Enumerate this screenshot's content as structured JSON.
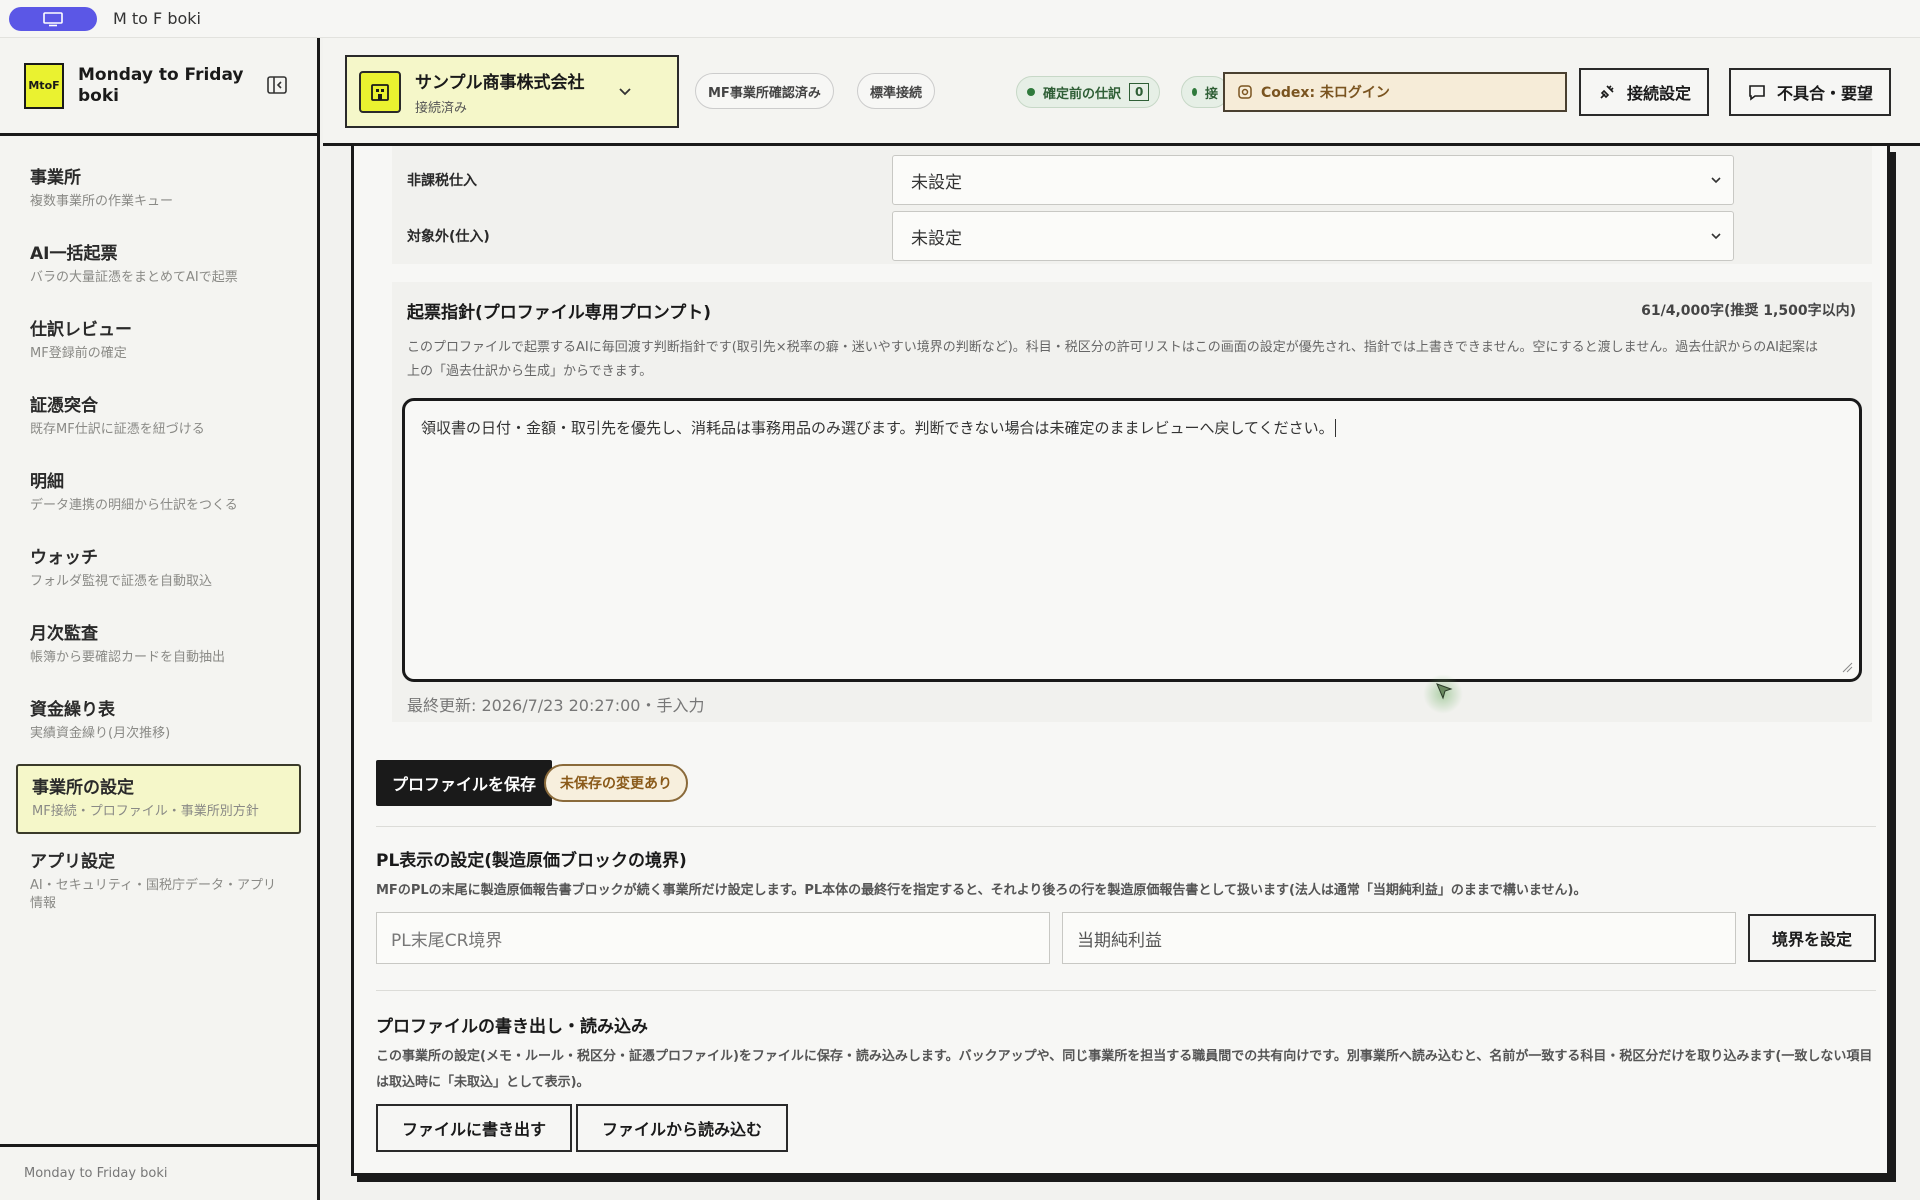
{
  "window": {
    "title": "M to F boki"
  },
  "brand": {
    "logo_text": "MtoF",
    "name": "Monday to Friday boki"
  },
  "sidebar": {
    "items": [
      {
        "title": "事業所",
        "subtitle": "複数事業所の作業キュー"
      },
      {
        "title": "AI一括起票",
        "subtitle": "バラの大量証憑をまとめてAIで起票"
      },
      {
        "title": "仕訳レビュー",
        "subtitle": "MF登録前の確定"
      },
      {
        "title": "証憑突合",
        "subtitle": "既存MF仕訳に証憑を紐づける"
      },
      {
        "title": "明細",
        "subtitle": "データ連携の明細から仕訳をつくる"
      },
      {
        "title": "ウォッチ",
        "subtitle": "フォルダ監視で証憑を自動取込"
      },
      {
        "title": "月次監査",
        "subtitle": "帳簿から要確認カードを自動抽出"
      },
      {
        "title": "資金繰り表",
        "subtitle": "実績資金繰り(月次推移)"
      },
      {
        "title": "事業所の設定",
        "subtitle": "MF接続・プロファイル・事業所別方針"
      },
      {
        "title": "アプリ設定",
        "subtitle": "AI・セキュリティ・国税庁データ・アプリ情報"
      }
    ],
    "footer": "Monday to Friday boki"
  },
  "header": {
    "company_name": "サンプル商事株式会社",
    "company_status": "接続済み",
    "pill_mf_office": "MF事業所確認済み",
    "pill_standard": "標準接続",
    "status_pending": "確定前の仕訳",
    "status_pending_count": "0",
    "status_second": "接",
    "codex_label": "Codex: 未ログイン",
    "connect_button": "接続設定",
    "feedback_button": "不具合・要望"
  },
  "settings": {
    "rows": [
      {
        "label": "非課税仕入",
        "value": "未設定"
      },
      {
        "label": "対象外(仕入)",
        "value": "未設定"
      }
    ]
  },
  "prompt": {
    "title": "起票指針(プロファイル専用プロンプト)",
    "count": "61/4,000字(推奨 1,500字以内)",
    "description": "このプロファイルで起票するAIに毎回渡す判断指針です(取引先×税率の癖・迷いやすい境界の判断など)。科目・税区分の許可リストはこの画面の設定が優先され、指針では上書きできません。空にすると渡しません。過去仕訳からのAI起案は上の「過去仕訳から生成」からできます。",
    "text": "領収書の日付・金額・取引先を優先し、消耗品は事務用品のみ選びます。判断できない場合は未確定のままレビューへ戻してください。",
    "updated": "最終更新: 2026/7/23 20:27:00・手入力"
  },
  "actions": {
    "save_button": "プロファイルを保存",
    "unsaved_badge": "未保存の変更あり"
  },
  "pl": {
    "title": "PL表示の設定(製造原価ブロックの境界)",
    "description": "MFのPLの末尾に製造原価報告書ブロックが続く事業所だけ設定します。PL本体の最終行を指定すると、それより後ろの行を製造原価報告書として扱います(法人は通常「当期純利益」のままで構いません)。",
    "input_placeholder": "PL末尾CR境界",
    "input_value": "当期純利益",
    "set_button": "境界を設定"
  },
  "export": {
    "title": "プロファイルの書き出し・読み込み",
    "description": "この事業所の設定(メモ・ルール・税区分・証憑プロファイル)をファイルに保存・読み込みします。バックアップや、同じ事業所を担当する職員間での共有向けです。別事業所へ読み込むと、名前が一致する科目・税区分だけを取り込みます(一致しない項目は取込時に「未取込」として表示)。",
    "export_button": "ファイルに書き出す",
    "import_button": "ファイルから読み込む"
  }
}
